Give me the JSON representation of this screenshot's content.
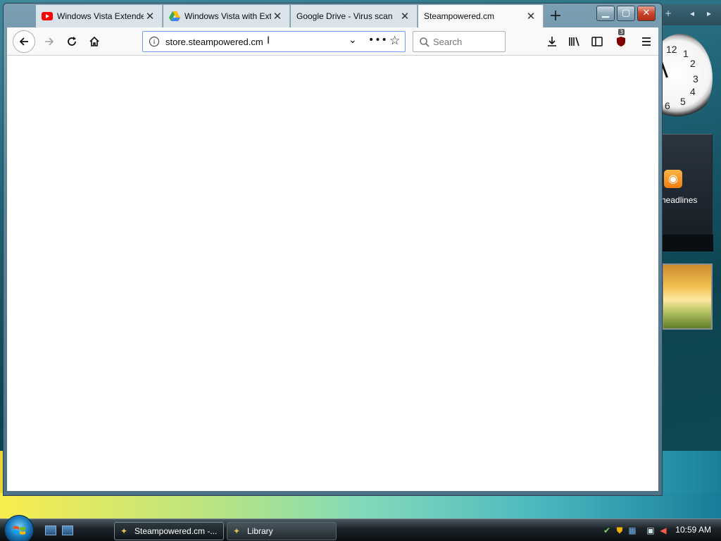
{
  "browser": {
    "tabs": [
      {
        "title": "Windows Vista Extended",
        "favicon": "youtube-icon",
        "active": false
      },
      {
        "title": "Windows Vista with Extended",
        "favicon": "google-drive-icon",
        "active": false
      },
      {
        "title": "Google Drive - Virus scan",
        "favicon": "none",
        "active": false
      },
      {
        "title": "Steampowered.cm",
        "favicon": "none",
        "active": true
      }
    ],
    "url": "store.steampowered.cm",
    "search_placeholder": "Search",
    "ublock_count": "3"
  },
  "gadgets": {
    "clock_numbers": [
      "12",
      "1",
      "2",
      "3",
      "4",
      "5",
      "6"
    ],
    "feeds_label": "headlines"
  },
  "taskbar": {
    "buttons": [
      {
        "label": "Steampowered.cm -...",
        "active": true
      },
      {
        "label": "Library",
        "active": false
      }
    ],
    "clock": "10:59 AM"
  },
  "colors": {
    "youtube_red": "#ff0000",
    "active_tab": "#f9f9fa",
    "url_focus_border": "#6d9ff0"
  }
}
